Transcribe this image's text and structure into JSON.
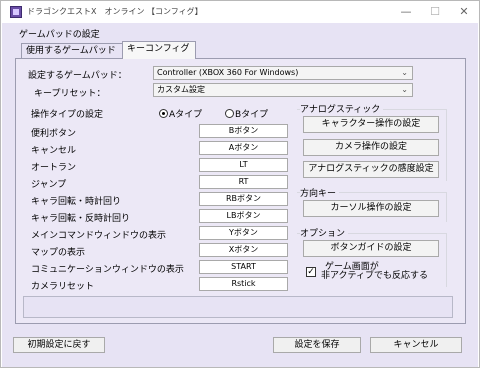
{
  "window": {
    "title": "ドラゴンクエストX　オンライン 【コンフィグ】"
  },
  "header": {
    "label": "ゲームパッドの設定"
  },
  "tabs": [
    {
      "label": "使用するゲームパッド"
    },
    {
      "label": "キーコンフィグ"
    }
  ],
  "gamepad": {
    "label": "設定するゲームパッド：",
    "value": "Controller (XBOX 360 For Windows)"
  },
  "preset": {
    "label": "キープリセット：",
    "value": "カスタム設定"
  },
  "op_type": {
    "label": "操作タイプの設定",
    "options": [
      "Aタイプ",
      "Bタイプ"
    ],
    "selected": "Aタイプ"
  },
  "bindings": [
    {
      "label": "便利ボタン",
      "value": "Bボタン"
    },
    {
      "label": "キャンセル",
      "value": "Aボタン"
    },
    {
      "label": "オートラン",
      "value": "LT"
    },
    {
      "label": "ジャンプ",
      "value": "RT"
    },
    {
      "label": "キャラ回転・時計回り",
      "value": "RBボタン"
    },
    {
      "label": "キャラ回転・反時計回り",
      "value": "LBボタン"
    },
    {
      "label": "メインコマンドウィンドウの表示",
      "value": "Yボタン"
    },
    {
      "label": "マップの表示",
      "value": "Xボタン"
    },
    {
      "label": "コミュニケーションウィンドウの表示",
      "value": "START"
    },
    {
      "label": "カメラリセット",
      "value": "Rstick"
    }
  ],
  "analog": {
    "title": "アナログスティック",
    "buttons": [
      "キャラクター操作の設定",
      "カメラ操作の設定",
      "アナログスティックの感度設定"
    ]
  },
  "dpad": {
    "title": "方向キー",
    "button": "カーソル操作の設定"
  },
  "options": {
    "title": "オプション",
    "button": "ボタンガイドの設定",
    "checkbox_line1": "ゲーム画面が",
    "checkbox_line2": "非アクティブでも反応する",
    "checked": true
  },
  "footer": {
    "reset": "初期設定に戻す",
    "save": "設定を保存",
    "cancel": "キャンセル"
  }
}
